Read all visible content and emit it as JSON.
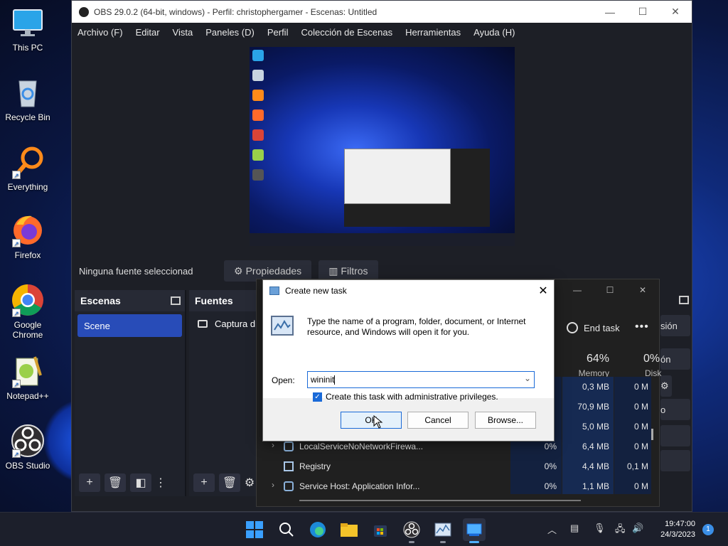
{
  "desktop": {
    "icons": [
      {
        "label": "This PC",
        "icon": "monitor-icon"
      },
      {
        "label": "Recycle Bin",
        "icon": "recycle-bin-icon"
      },
      {
        "label": "Everything",
        "icon": "magnifier-icon"
      },
      {
        "label": "Firefox",
        "icon": "firefox-icon"
      },
      {
        "label": "Google Chrome",
        "icon": "chrome-icon"
      },
      {
        "label": "Notepad++",
        "icon": "notepad-icon"
      },
      {
        "label": "OBS Studio",
        "icon": "obs-icon"
      }
    ]
  },
  "obs": {
    "title": "OBS 29.0.2 (64-bit, windows) - Perfil: christophergamer - Escenas: Untitled",
    "menu": [
      "Archivo (F)",
      "Editar",
      "Vista",
      "Paneles (D)",
      "Perfil",
      "Colección de Escenas",
      "Herramientas",
      "Ayuda (H)"
    ],
    "no_source": "Ninguna fuente seleccionad",
    "properties_label": "Propiedades",
    "filters_label": "Filtros",
    "scenes_title": "Escenas",
    "scene_item": "Scene",
    "sources_title": "Fuentes",
    "source_item": "Captura d",
    "controls_fragments": [
      "sión",
      "ón",
      "o"
    ]
  },
  "task_manager": {
    "end_task": "End task",
    "memory_pct": "64%",
    "memory_label": "Memory",
    "disk_pct": "0%",
    "disk_label": "Disk",
    "rows": [
      {
        "name": "",
        "cpu": "",
        "mem": "0,3 MB",
        "disk": "0 M"
      },
      {
        "name": "",
        "cpu": "",
        "mem": "70,9 MB",
        "disk": "0 M"
      },
      {
        "name": "",
        "cpu": "",
        "mem": "5,0 MB",
        "disk": "0 M"
      },
      {
        "name": "LocalServiceNoNetworkFirewa...",
        "cpu": "0%",
        "mem": "6,4 MB",
        "disk": "0 M"
      },
      {
        "name": "Registry",
        "cpu": "0%",
        "mem": "4,4 MB",
        "disk": "0,1 M"
      },
      {
        "name": "Service Host: Application Infor...",
        "cpu": "0%",
        "mem": "1,1 MB",
        "disk": "0 M"
      }
    ]
  },
  "run_dialog": {
    "title": "Create new task",
    "description": "Type the name of a program, folder, document, or Internet resource, and Windows will open it for you.",
    "open_label": "Open:",
    "open_value": "wininit",
    "admin_label": "Create this task with administrative privileges.",
    "ok_label": "OK",
    "cancel_label": "Cancel",
    "browse_label": "Browse..."
  },
  "taskbar": {
    "time": "19:47:00",
    "date": "24/3/2023",
    "notification_count": "1"
  }
}
